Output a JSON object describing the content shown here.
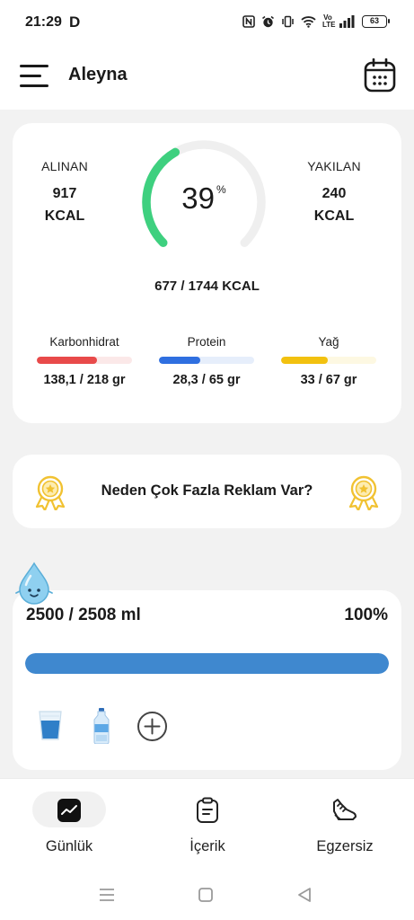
{
  "status_bar": {
    "time": "21:29",
    "carrier_glyph": "D",
    "network_text": "Vo LTE",
    "battery": "63",
    "icons": [
      "nfc-icon",
      "alarm-icon",
      "vibrate-icon",
      "wifi-icon",
      "volte-icon",
      "signal-icon",
      "battery-icon"
    ]
  },
  "header": {
    "title": "Aleyna",
    "menu_icon": "menu-icon",
    "calendar_icon": "calendar-icon"
  },
  "calories": {
    "consumed_label": "ALINAN",
    "consumed_value": "917",
    "consumed_unit": "KCAL",
    "burned_label": "YAKILAN",
    "burned_value": "240",
    "burned_unit": "KCAL",
    "percent": "39",
    "percent_sign": "%",
    "progress_fraction": 0.39,
    "total": "677 / 1744 KCAL",
    "ring_color": "#3ed07f",
    "ring_track_color": "#efefef"
  },
  "macros": [
    {
      "label": "Karbonhidrat",
      "value": "138,1 / 218 gr",
      "fraction": 0.63,
      "color": "#e84a4a",
      "track": "#fbe8e8"
    },
    {
      "label": "Protein",
      "value": "28,3 / 65 gr",
      "fraction": 0.435,
      "color": "#2f6fe0",
      "track": "#e6eefb"
    },
    {
      "label": "Yağ",
      "value": "33 / 67 gr",
      "fraction": 0.49,
      "color": "#f2c10f",
      "track": "#fdf8e2"
    }
  ],
  "ad_banner": {
    "text": "Neden Çok Fazla Reklam Var?",
    "icon": "medal-icon",
    "icon_color": "#f1c232"
  },
  "water": {
    "amount": "2500 / 2508 ml",
    "percent": "100%",
    "fill_fraction": 1.0,
    "bar_color": "#3f88cf",
    "mascot_icon": "water-drop-icon",
    "actions": [
      "glass-icon",
      "bottle-icon",
      "add-icon"
    ]
  },
  "bottom_nav": {
    "items": [
      {
        "label": "Günlük",
        "icon": "chart-icon",
        "active": true
      },
      {
        "label": "İçerik",
        "icon": "clipboard-icon",
        "active": false
      },
      {
        "label": "Egzersiz",
        "icon": "sneaker-icon",
        "active": false
      }
    ]
  },
  "system_nav": {
    "icons": [
      "recent-apps-icon",
      "home-icon",
      "back-icon"
    ]
  }
}
